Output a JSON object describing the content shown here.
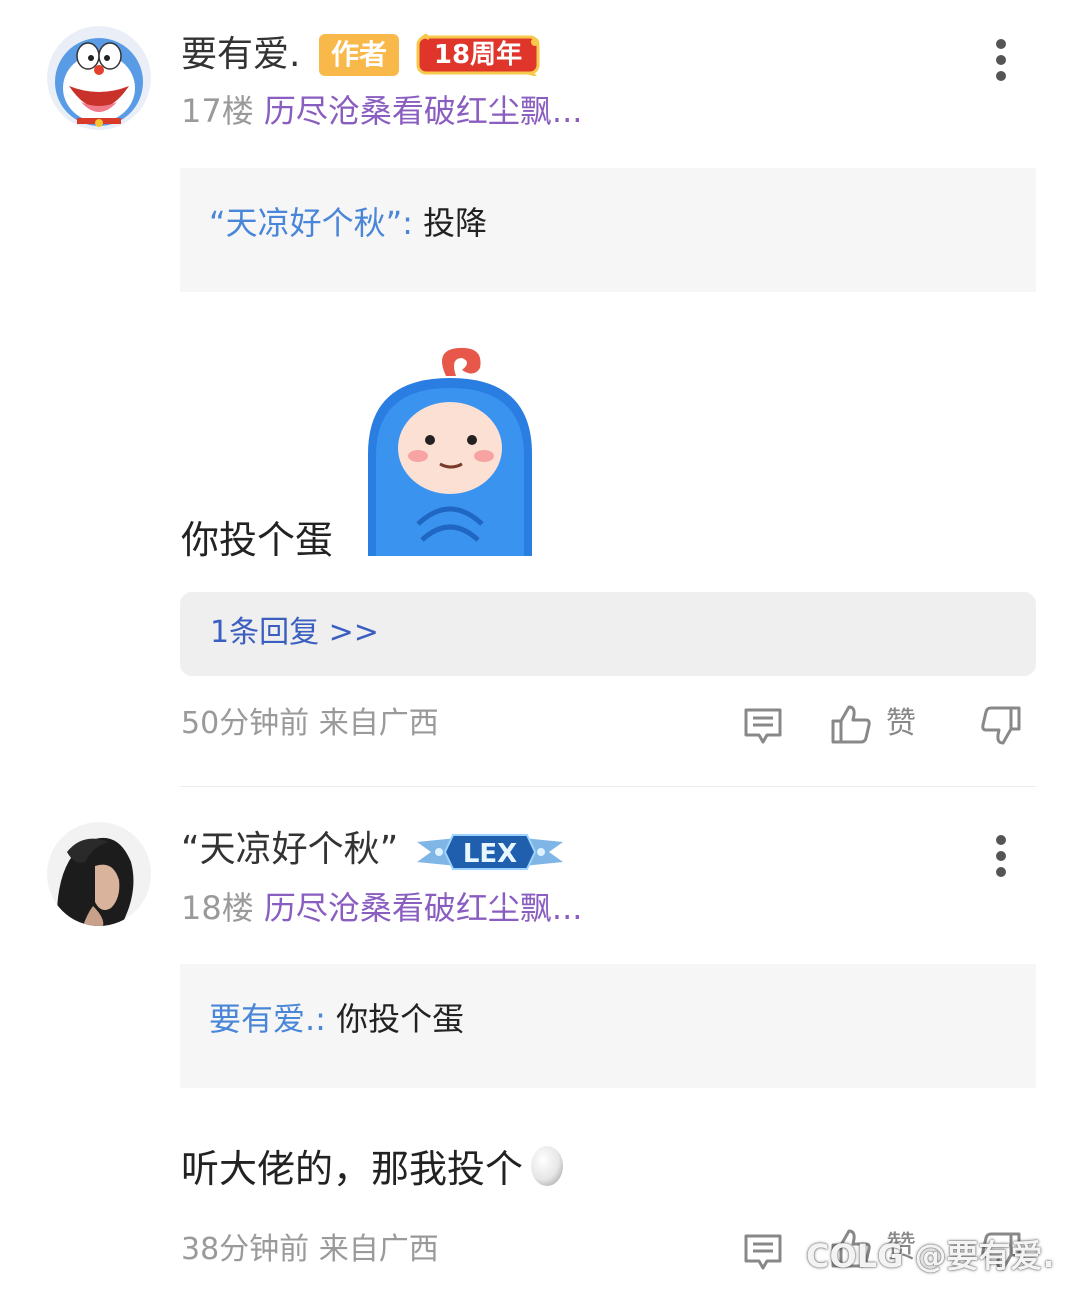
{
  "posts": [
    {
      "username": "要有爱.",
      "author_badge": "作者",
      "anniversary_badge": "18周年",
      "floor": "17楼",
      "thread_title": "历尽沧桑看破红尘飘...",
      "quote_author": "“天凉好个秋”:",
      "quote_text": "投降",
      "body": "你投个蛋",
      "replies_link": "1条回复 >>",
      "meta": "50分钟前 来自广西",
      "like_label": "赞"
    },
    {
      "username": "“天凉好个秋”",
      "level_badge": "LEX",
      "floor": "18楼",
      "thread_title": "历尽沧桑看破红尘飘...",
      "quote_author": "要有爱.:",
      "quote_text": "你投个蛋",
      "body": "听大佬的，那我投个",
      "meta": "38分钟前 来自广西",
      "like_label": "赞"
    }
  ],
  "watermark": "COLG @要有爱.",
  "icons": {
    "more": "more-vertical-icon",
    "comment": "comment-icon",
    "like": "thumbs-up-icon",
    "dislike": "thumbs-down-icon",
    "egg": "egg-emoji-icon",
    "sticker": "blue-bean-sticker"
  },
  "colors": {
    "floor_gray": "#9a9a9a",
    "thread_purple": "#8a5ec0",
    "quote_blue": "#4a86d8",
    "reply_link_blue": "#3a5fc0",
    "author_badge": "#f9b84a",
    "quote_bg": "#f6f6f6",
    "reply_bg": "#efefef"
  }
}
